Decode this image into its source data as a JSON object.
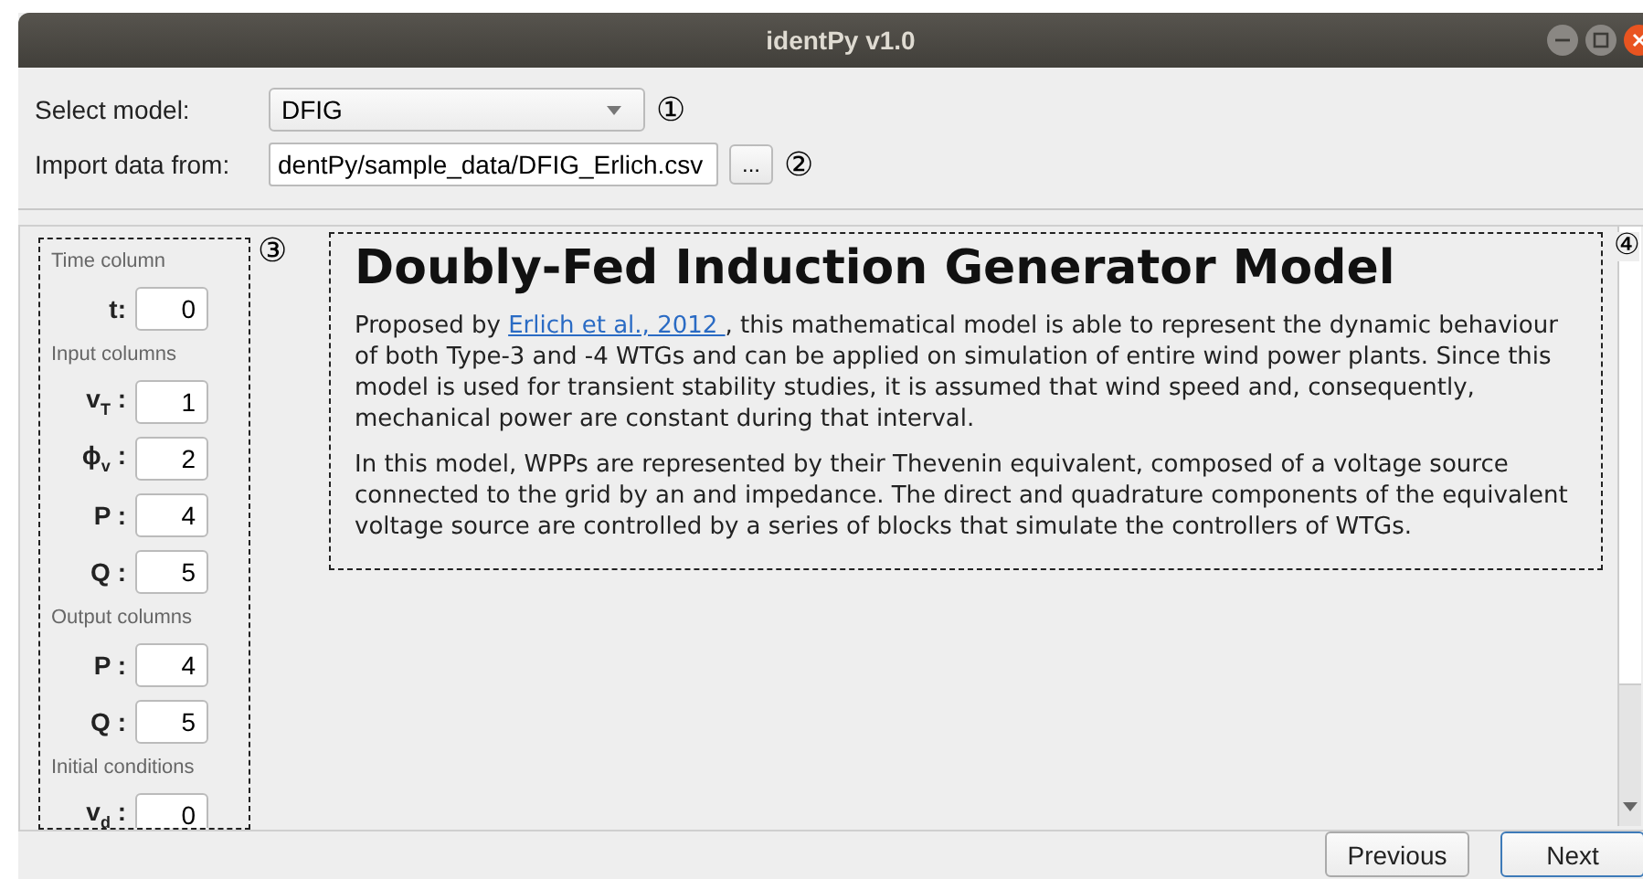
{
  "window": {
    "title": "identPy v1.0"
  },
  "model_select": {
    "label": "Select model:",
    "value": "DFIG",
    "marker": "①"
  },
  "import": {
    "label": "Import data from:",
    "value": "dentPy/sample_data/DFIG_Erlich.csv",
    "browse": "...",
    "marker": "②"
  },
  "columns_panel": {
    "marker": "③",
    "groups": [
      {
        "title": "Time column",
        "fields": [
          {
            "label": "t:",
            "value": "0"
          }
        ]
      },
      {
        "title": "Input columns",
        "fields": [
          {
            "label": "v$_{T}$ :",
            "value": "1"
          },
          {
            "label": "ϕ$_{v}$ :",
            "value": "2"
          },
          {
            "label": "P :",
            "value": "4"
          },
          {
            "label": "Q :",
            "value": "5"
          }
        ]
      },
      {
        "title": "Output columns",
        "fields": [
          {
            "label": "P :",
            "value": "4"
          },
          {
            "label": "Q :",
            "value": "5"
          }
        ]
      },
      {
        "title": "Initial conditions",
        "fields": [
          {
            "label": "v$_{d}$ :",
            "value": "0"
          }
        ]
      }
    ]
  },
  "description": {
    "marker": "④",
    "heading": "Doubly-Fed Induction Generator Model",
    "paragraphs": [
      {
        "before": "Proposed by ",
        "link": "Erlich et al., 2012 ",
        "after": ", this mathematical model is able to represent the dynamic behaviour of both Type-3 and -4 WTGs and can be applied on simulation of entire wind power plants. Since this model is used for transient stability studies, it is assumed that wind speed and, consequently, mechanical power are constant during that interval."
      },
      {
        "before": "In this model, WPPs are represented by their Thevenin equivalent, composed of a voltage source connected to the grid by an and impedance. The direct and quadrature components of the equivalent voltage source are controlled by a series of blocks that simulate the controllers of WTGs."
      }
    ]
  },
  "buttons": [
    {
      "label": "Previous",
      "default": false
    },
    {
      "label": "Next",
      "default": true
    }
  ]
}
